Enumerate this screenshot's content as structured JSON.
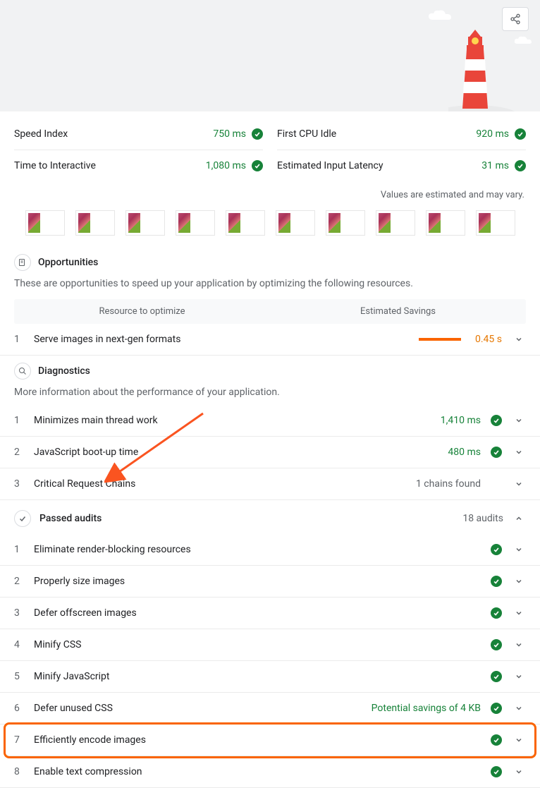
{
  "metrics": [
    {
      "label": "Speed Index",
      "value": "750 ms"
    },
    {
      "label": "First CPU Idle",
      "value": "920 ms"
    },
    {
      "label": "Time to Interactive",
      "value": "1,080 ms"
    },
    {
      "label": "Estimated Input Latency",
      "value": "31 ms"
    }
  ],
  "estimateNote": "Values are estimated and may vary.",
  "opportunities": {
    "title": "Opportunities",
    "desc": "These are opportunities to speed up your application by optimizing the following resources.",
    "col1": "Resource to optimize",
    "col2": "Estimated Savings",
    "items": [
      {
        "num": "1",
        "label": "Serve images in next-gen formats",
        "savings": "0.45 s"
      }
    ]
  },
  "diagnostics": {
    "title": "Diagnostics",
    "desc": "More information about the performance of your application.",
    "items": [
      {
        "num": "1",
        "label": "Minimizes main thread work",
        "value": "1,410 ms",
        "pass": true
      },
      {
        "num": "2",
        "label": "JavaScript boot-up time",
        "value": "480 ms",
        "pass": true
      },
      {
        "num": "3",
        "label": "Critical Request Chains",
        "value": "1 chains found",
        "pass": false
      }
    ]
  },
  "passed": {
    "title": "Passed audits",
    "count": "18 audits",
    "items": [
      {
        "num": "1",
        "label": "Eliminate render-blocking resources"
      },
      {
        "num": "2",
        "label": "Properly size images"
      },
      {
        "num": "3",
        "label": "Defer offscreen images"
      },
      {
        "num": "4",
        "label": "Minify CSS"
      },
      {
        "num": "5",
        "label": "Minify JavaScript"
      },
      {
        "num": "6",
        "label": "Defer unused CSS",
        "extra": "Potential savings of 4 KB"
      },
      {
        "num": "7",
        "label": "Efficiently encode images",
        "highlight": true
      },
      {
        "num": "8",
        "label": "Enable text compression"
      }
    ]
  }
}
